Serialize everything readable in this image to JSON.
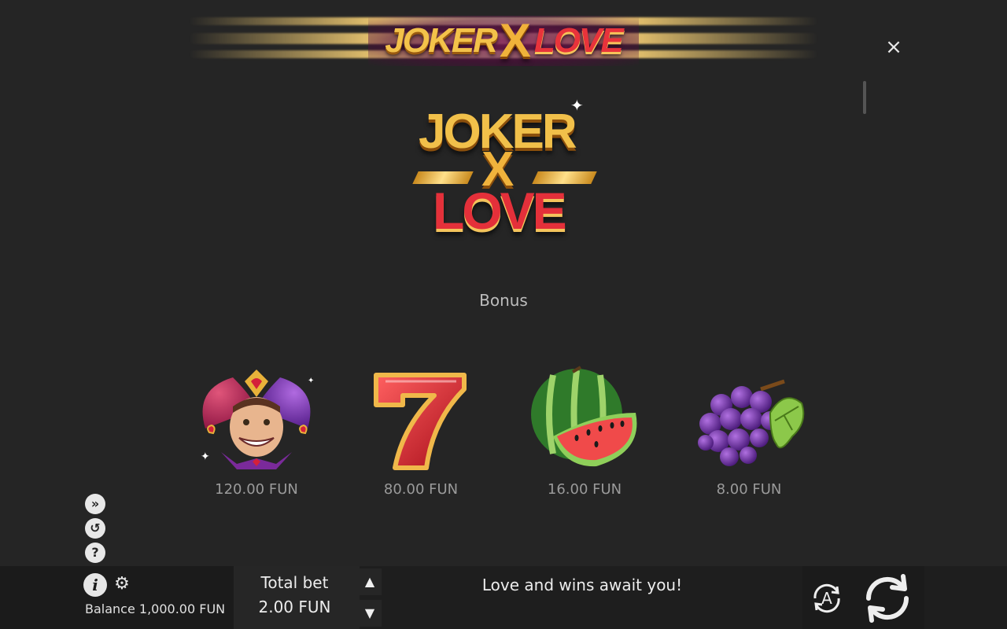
{
  "header": {
    "logo_word1": "JOKER",
    "logo_x": "X",
    "logo_word2": "LOVE",
    "close_label": "×"
  },
  "big_logo": {
    "word1": "JOKER",
    "x": "X",
    "word2": "LOVE"
  },
  "section": {
    "title": "Bonus"
  },
  "symbols": [
    {
      "name": "joker",
      "payout": "120.00 FUN"
    },
    {
      "name": "seven",
      "payout": "80.00 FUN"
    },
    {
      "name": "watermelon",
      "payout": "16.00 FUN"
    },
    {
      "name": "grapes",
      "payout": "8.00 FUN"
    }
  ],
  "side_icons": [
    {
      "icon": "turbo-icon",
      "glyph": "»"
    },
    {
      "icon": "history-icon",
      "glyph": "↺"
    },
    {
      "icon": "help-icon",
      "glyph": "?"
    }
  ],
  "bottom": {
    "info_glyph": "i",
    "gear_glyph": "⚙",
    "balance_text": "Balance 1,000.00 FUN",
    "bet_label": "Total bet",
    "bet_value": "2.00 FUN",
    "bet_up_glyph": "▲",
    "bet_down_glyph": "▼",
    "message": "Love and wins await you!",
    "auto_label": "A"
  },
  "colors": {
    "background": "#252525",
    "gold": "#f1c04a",
    "red": "#e4303a"
  }
}
